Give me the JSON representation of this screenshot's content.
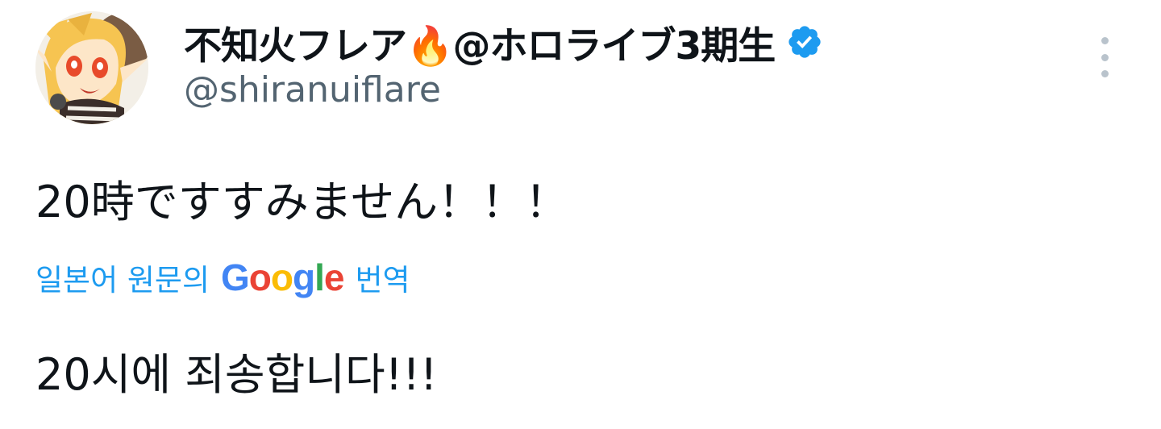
{
  "author": {
    "display_name": "不知火フレア🔥@ホロライブ3期生",
    "handle": "@shiranuiflare",
    "verified": true,
    "verified_color": "#1d9bf0"
  },
  "tweet": {
    "text": "20時ですすみません！！！"
  },
  "translation": {
    "prefix": "일본어 원문의",
    "provider_letters": [
      {
        "ch": "G",
        "color": "#4285f4"
      },
      {
        "ch": "o",
        "color": "#ea4335"
      },
      {
        "ch": "o",
        "color": "#fbbc05"
      },
      {
        "ch": "g",
        "color": "#4285f4"
      },
      {
        "ch": "l",
        "color": "#34a853"
      },
      {
        "ch": "e",
        "color": "#ea4335"
      }
    ],
    "suffix": "번역",
    "text": "20시에 죄송합니다!!!"
  },
  "icons": {
    "more": "more-vertical-icon",
    "verified": "verified-badge-icon"
  }
}
